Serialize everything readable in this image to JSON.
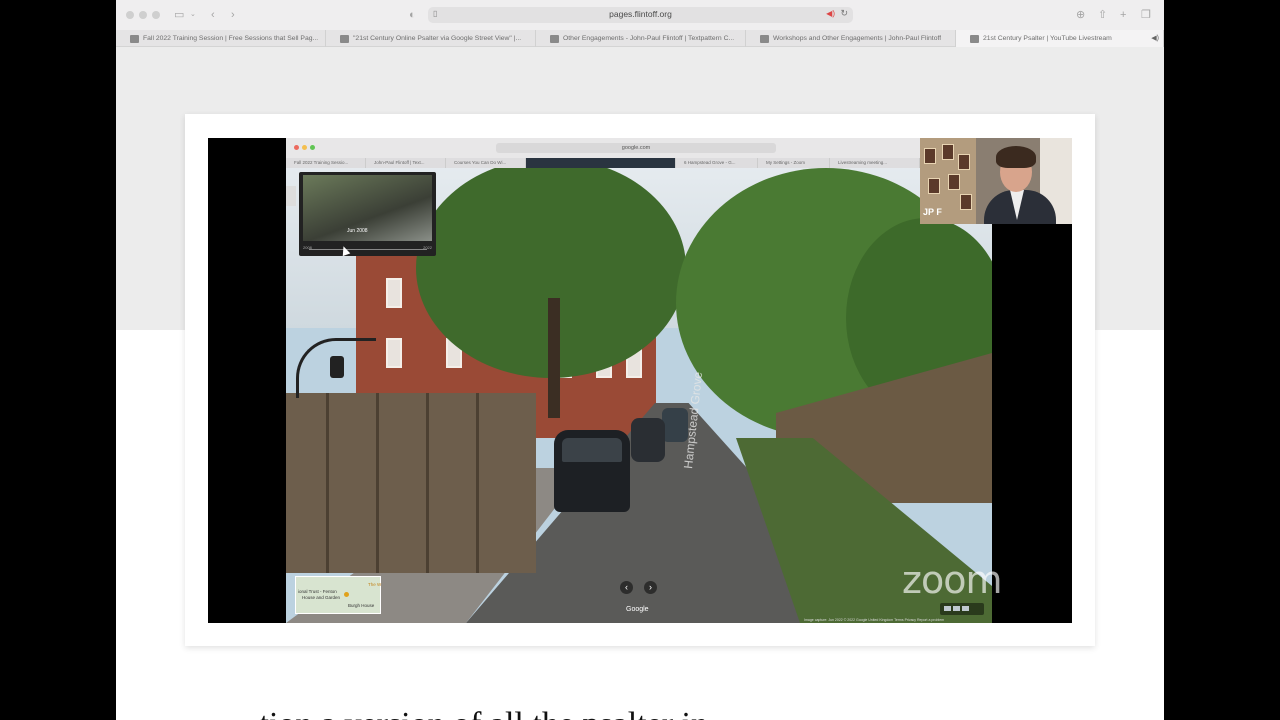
{
  "browser": {
    "url": "pages.flintoff.org",
    "tabs": [
      {
        "label": "Fall 2022 Training Session | Free Sessions that Sell Pag...",
        "active": false
      },
      {
        "label": "\"21st Century Online Psalter via Google Street View\" |...",
        "active": false
      },
      {
        "label": "Other Engagements - John-Paul Flintoff | Textpattern C...",
        "active": false
      },
      {
        "label": "Workshops and Other Engagements | John-Paul Flintoff",
        "active": false
      },
      {
        "label": "21st Century Psalter | YouTube Livestream",
        "active": true
      }
    ]
  },
  "shared_screen": {
    "inner_url": "google.com",
    "inner_tabs": [
      "Fall 2022 Training Sessio...",
      "John-Paul Flintoff | Text...",
      "Courses You Can Do Wi...",
      "",
      "6 Hampstead Grove - G...",
      "My Settings - Zoom",
      "Livestreaming meeting..."
    ],
    "street_view": {
      "date_label": "Jun 2008",
      "year_start": "2008",
      "year_end": "2022",
      "street_name": "Hampstead Grove",
      "google_label": "Google",
      "fineprint": "Image capture: Jun 2022   © 2022 Google   United Kingdom   Terms   Privacy   Report a problem",
      "map_labels": [
        "The W",
        "ional Trust - Fenton",
        "House and Garden",
        "Burgh House"
      ]
    }
  },
  "participant": {
    "name": "JP F"
  },
  "zoom_watermark": "zoom",
  "bottom_text": "...tion  a version of  all the  psalter in..."
}
